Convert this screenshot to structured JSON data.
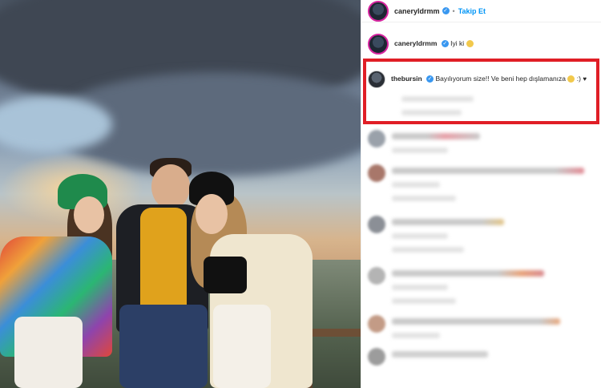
{
  "post": {
    "author": "caneryldrmm",
    "follow_label": "Takip Et",
    "dot": "•"
  },
  "comments": [
    {
      "user": "caneryldrmm",
      "text": "Iyi ki"
    },
    {
      "user": "thebursin",
      "text": "Bayılıyorum size!! Ve beni hep dışlamanıza",
      "suffix": ":)"
    }
  ],
  "colors": {
    "highlight_border": "#e01e26",
    "verified": "#3897f0",
    "follow": "#0095f6"
  },
  "icons": [
    "verified-badge-icon",
    "smile-emoji-icon",
    "heart-icon"
  ]
}
